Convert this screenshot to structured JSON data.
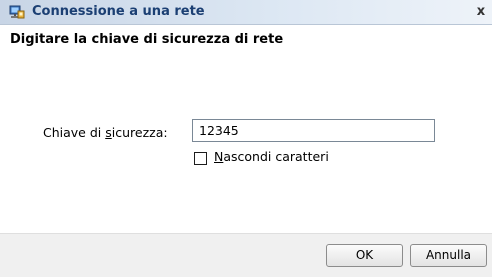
{
  "window": {
    "title": "Connessione a una rete",
    "close_glyph": "x",
    "icon": "network-icon"
  },
  "main": {
    "heading": "Digitare la chiave di sicurezza di rete",
    "key_label_before": "Chiave di ",
    "key_label_accel": "s",
    "key_label_after": "icurezza:",
    "key_value": "12345",
    "hide_chars_accel": "N",
    "hide_chars_rest": "ascondi caratteri",
    "hide_chars_checked": false
  },
  "footer": {
    "ok_label": "OK",
    "cancel_label": "Annulla"
  }
}
